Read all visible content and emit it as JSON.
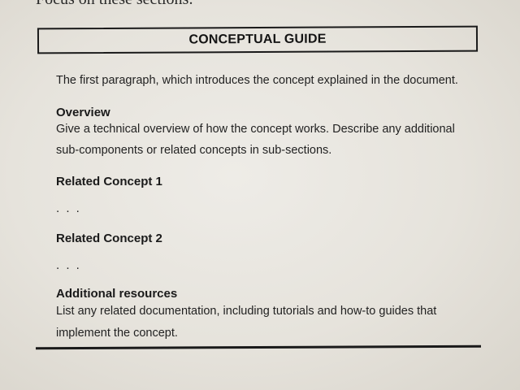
{
  "top_text": "Focus on these sections:",
  "box_title": "CONCEPTUAL GUIDE",
  "intro": "The first paragraph, which introduces the concept explained in the document.",
  "sections": {
    "overview": {
      "heading": "Overview",
      "line1": "Give a technical overview of how the concept works. Describe any additional",
      "line2": "sub-components or related concepts in sub-sections."
    },
    "related1": {
      "heading": "Related Concept 1",
      "body": ". . ."
    },
    "related2": {
      "heading": "Related Concept 2",
      "body": ". . ."
    },
    "resources": {
      "heading": "Additional resources",
      "line1": "List any related documentation, including tutorials and how-to guides that",
      "line2": "implement the concept."
    }
  }
}
